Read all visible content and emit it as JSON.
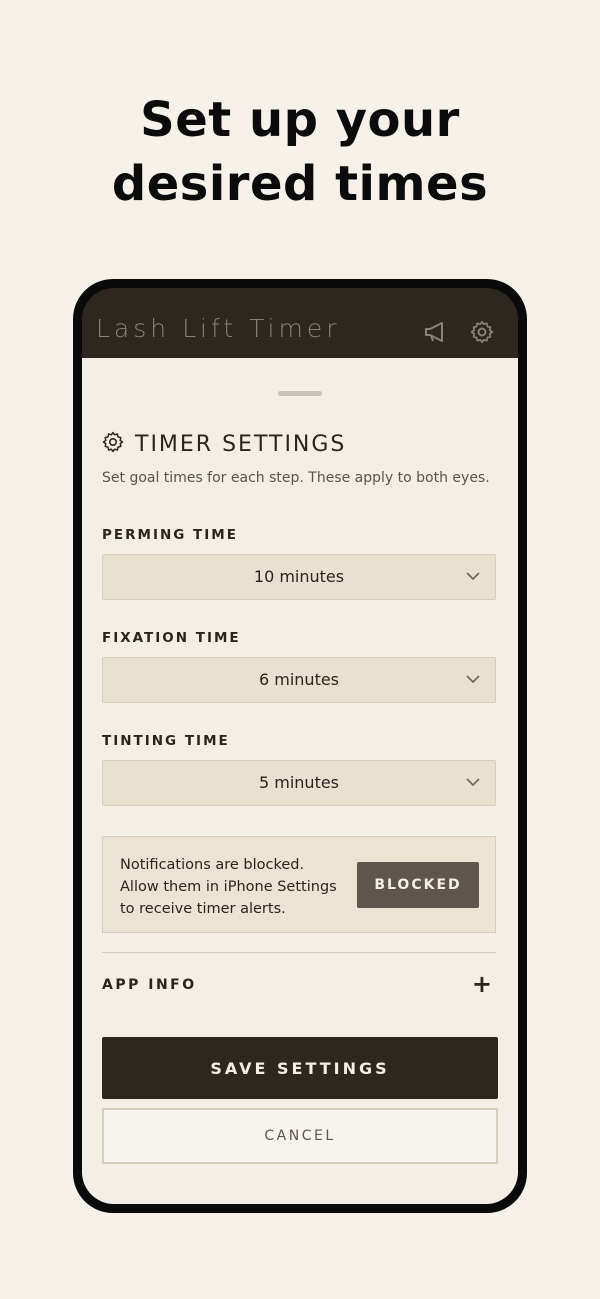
{
  "headline": {
    "line1": "Set up your",
    "line2": "desired times"
  },
  "app_bar": {
    "title": "Lash Lift Timer",
    "icons": [
      "megaphone-icon",
      "gear-icon"
    ]
  },
  "sheet": {
    "title": "TIMER SETTINGS",
    "title_icon": "gear-icon",
    "subtitle": "Set goal times for each step. These apply to both eyes.",
    "fields": [
      {
        "label": "PERMING TIME",
        "value": "10 minutes"
      },
      {
        "label": "FIXATION TIME",
        "value": "6 minutes"
      },
      {
        "label": "TINTING TIME",
        "value": "5 minutes"
      }
    ],
    "notice": {
      "lines": [
        "Notifications are blocked.",
        "Allow them in iPhone Settings",
        "to receive timer alerts."
      ],
      "button": "BLOCKED"
    },
    "app_info": {
      "label": "APP INFO",
      "toggle": "+"
    },
    "save_button": "SAVE SETTINGS",
    "cancel_button": "CANCEL"
  },
  "colors": {
    "background": "#f6f2ea",
    "appbar": "#2e2720",
    "sheet": "#f3efe6",
    "select": "#e8e0d1",
    "primary_button": "#2e2720",
    "blocked_button": "#5e554d"
  }
}
